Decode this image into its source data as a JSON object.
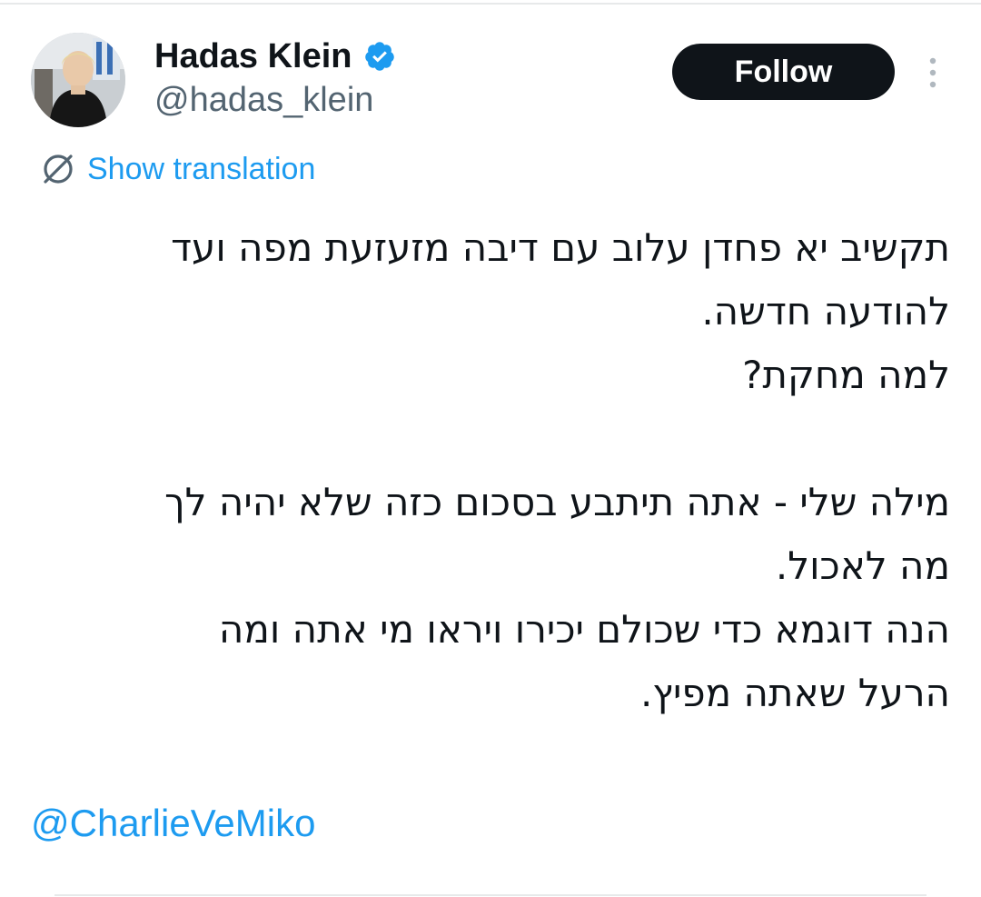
{
  "author": {
    "display_name": "Hadas Klein",
    "handle": "@hadas_klein",
    "verified": true
  },
  "actions": {
    "follow_label": "Follow"
  },
  "translation": {
    "label": "Show translation"
  },
  "tweet": {
    "lines": [
      "תקשיב יא פחדן עלוב עם דיבה מזעזעת מפה ועד",
      "להודעה חדשה.",
      "למה מחקת?",
      "",
      "מילה שלי - אתה תיתבע בסכום כזה שלא יהיה לך",
      "מה לאכול.",
      "הנה דוגמא כדי שכולם יכירו ויראו מי אתה ומה",
      "הרעל שאתה מפיץ."
    ],
    "mention": "@CharlieVeMiko"
  },
  "colors": {
    "link": "#1d9bf0",
    "text": "#0f1419",
    "secondary": "#536471",
    "follow_bg": "#0f1419",
    "verified": "#1d9bf0"
  },
  "icons": {
    "verified": "verified-badge-icon",
    "translate": "translate-globe-icon",
    "more": "more-vertical-icon"
  }
}
